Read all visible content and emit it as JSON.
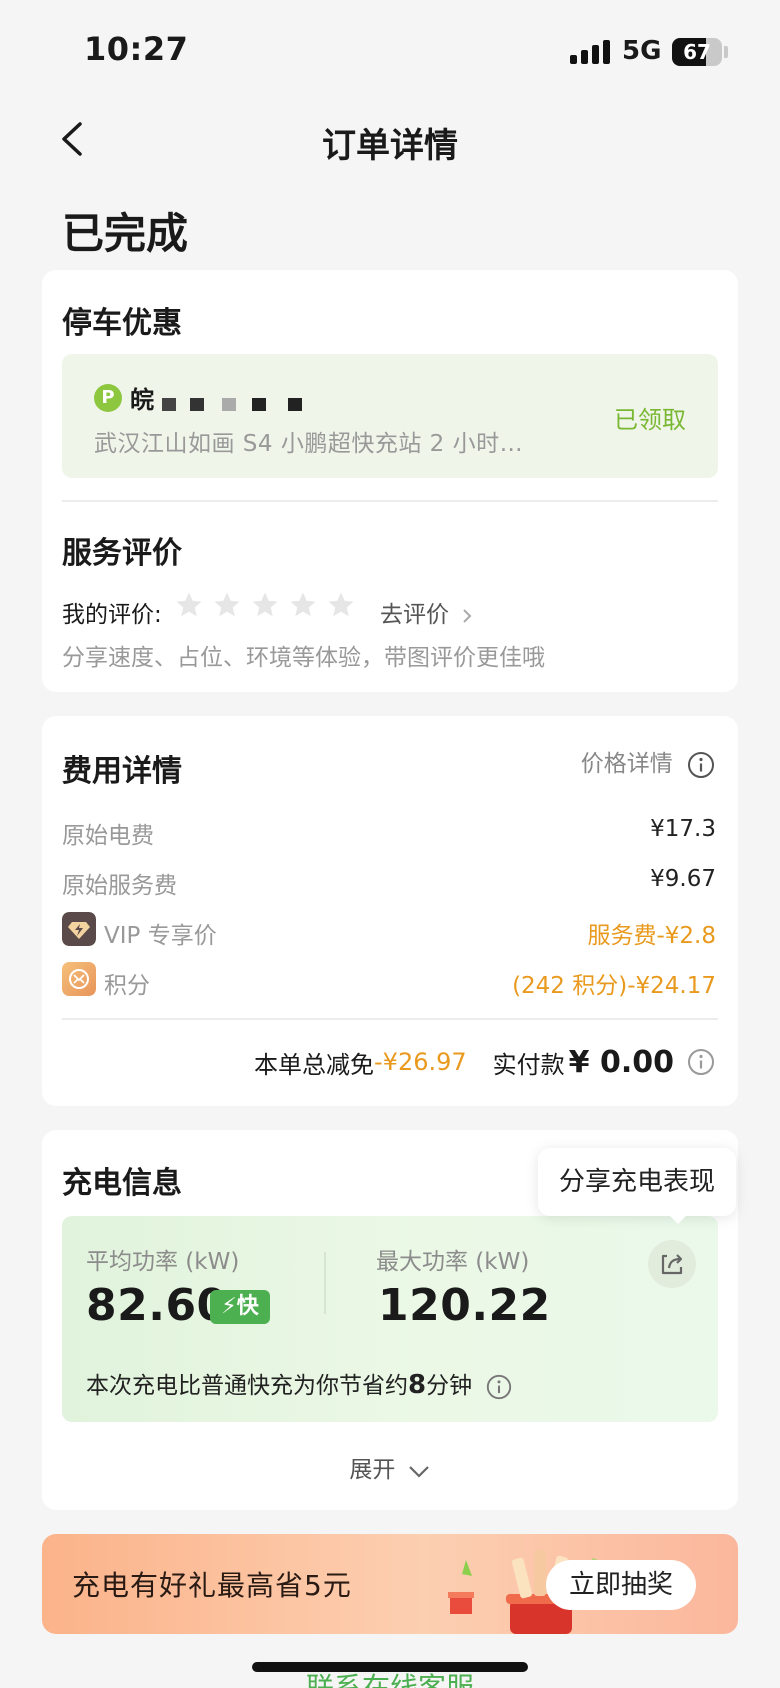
{
  "status_bar": {
    "time": "10:27",
    "network": "5G",
    "battery": "67"
  },
  "nav": {
    "title": "订单详情",
    "back_icon": "chevron-left-icon"
  },
  "order_status": "已完成",
  "parking": {
    "title": "停车优惠",
    "plate_prefix": "皖",
    "station": "武汉江山如画 S4 小鹏超快充站 2 小时…",
    "status": "已领取"
  },
  "rating": {
    "title": "服务评价",
    "label": "我的评价:",
    "stars": 0,
    "go_label": "去评价",
    "hint": "分享速度、占位、环境等体验，带图评价更佳哦"
  },
  "fees": {
    "title": "费用详情",
    "price_detail_label": "价格详情",
    "rows": [
      {
        "label": "原始电费",
        "value": "¥17.3"
      },
      {
        "label": "原始服务费",
        "value": "¥9.67"
      }
    ],
    "vip": {
      "label": "VIP 专享价",
      "value": "服务费-¥2.8"
    },
    "points": {
      "label": "积分",
      "value": "(242 积分)-¥24.17"
    },
    "total_discount_label": "本单总减免",
    "total_discount": "-¥26.97",
    "paid_label": "实付款",
    "paid_amount": "¥ 0.00"
  },
  "charging": {
    "title": "充电信息",
    "share_tooltip": "分享充电表现",
    "avg_power_label": "平均功率 (kW)",
    "avg_power": "82.60",
    "fast_badge": "快",
    "max_power_label": "最大功率 (kW)",
    "max_power": "120.22",
    "save_prefix": "本次充电比普通快充为你节省约",
    "save_minutes": "8",
    "save_suffix": "分钟",
    "expand_label": "展开"
  },
  "banner": {
    "text": "充电有好礼最高省5元",
    "button": "立即抽奖"
  },
  "footer": {
    "link": "联系在线客服"
  },
  "colors": {
    "accent_green": "#7ab834",
    "discount_orange": "#e99a1e",
    "badge_green": "#4caf50"
  }
}
